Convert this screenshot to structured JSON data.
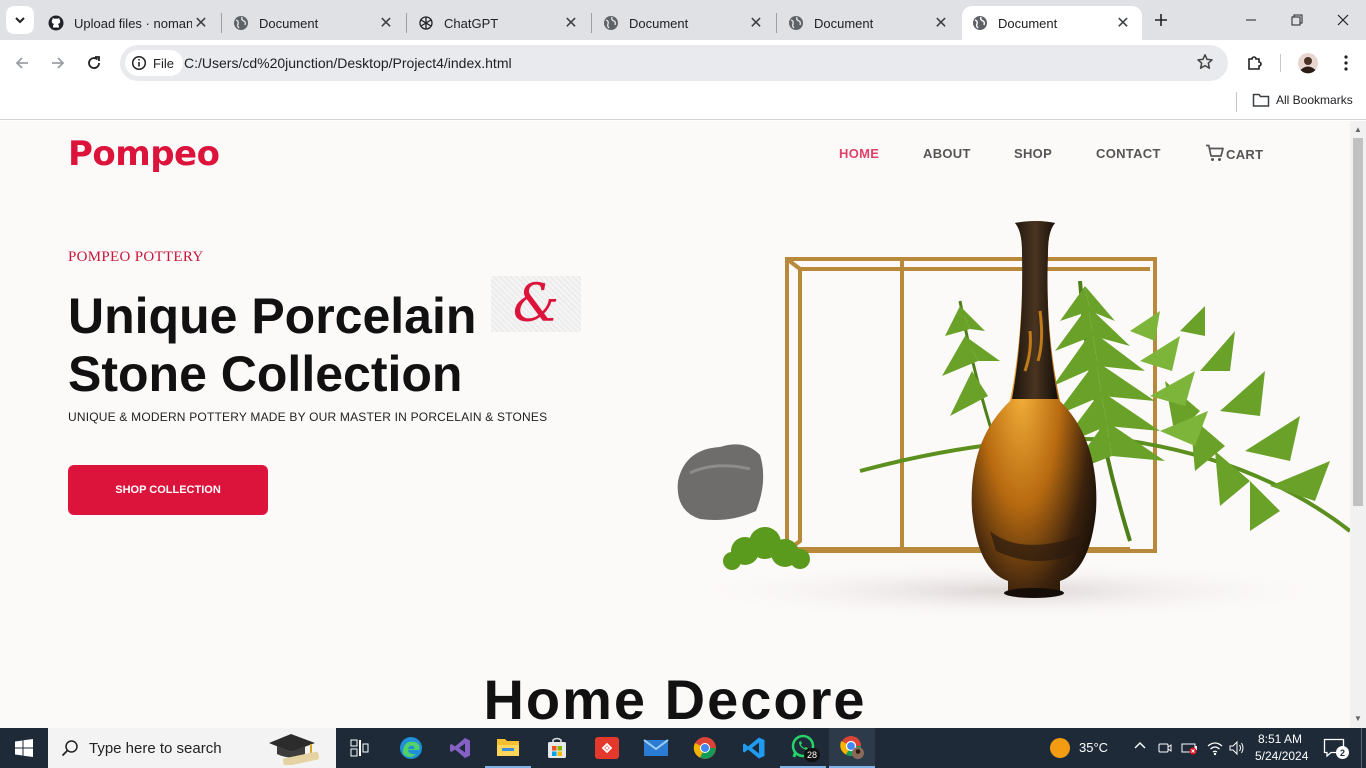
{
  "browser": {
    "tabs": [
      {
        "title": "Upload files · nomanu",
        "icon": "github-icon",
        "active": false
      },
      {
        "title": "Document",
        "icon": "globe-icon",
        "active": false
      },
      {
        "title": "ChatGPT",
        "icon": "chatgpt-icon",
        "active": false
      },
      {
        "title": "Document",
        "icon": "globe-icon",
        "active": false
      },
      {
        "title": "Document",
        "icon": "globe-icon",
        "active": false
      },
      {
        "title": "Document",
        "icon": "globe-icon",
        "active": true
      }
    ],
    "site_chip": "File",
    "url": "C:/Users/cd%20junction/Desktop/Project4/index.html",
    "bookmarks_label": "All Bookmarks"
  },
  "page": {
    "logo": "Pompeo",
    "nav": [
      {
        "label": "HOME",
        "active": true
      },
      {
        "label": "ABOUT",
        "active": false
      },
      {
        "label": "SHOP",
        "active": false
      },
      {
        "label": "CONTACT",
        "active": false
      },
      {
        "label": "CART",
        "active": false,
        "icon": "cart-icon"
      }
    ],
    "hero": {
      "eyebrow": "POMPEO POTTERY",
      "title_line1": "Unique Porcelain",
      "title_line2": "Stone Collection",
      "ampersand": "&",
      "subtitle": "UNIQUE & MODERN POTTERY MADE BY OUR MASTER IN PORCELAIN & STONES",
      "cta": "SHOP COLLECTION"
    },
    "section_title": "Home Decore",
    "colors": {
      "accent": "#dc143c",
      "nav_active": "#e0426a",
      "background": "#fcf9f9"
    }
  },
  "taskbar": {
    "search_placeholder": "Type here to search",
    "apps": [
      "task-view-icon",
      "edge-icon",
      "visual-studio-icon",
      "file-explorer-icon",
      "microsoft-store-icon",
      "git-icon",
      "mail-icon",
      "chrome-icon",
      "vscode-icon",
      "whatsapp-icon",
      "chrome-profile-icon"
    ],
    "whatsapp_badge": "28",
    "weather": "35°C",
    "time": "8:51 AM",
    "date": "5/24/2024",
    "notification_count": "2"
  }
}
